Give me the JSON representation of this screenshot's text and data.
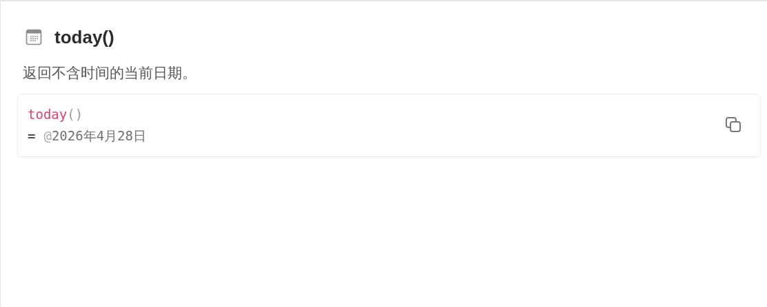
{
  "title": "today()",
  "description": "返回不含时间的当前日期。",
  "code_block": {
    "lines": [
      {
        "tokens": [
          {
            "kind": "function",
            "text": "today"
          },
          {
            "kind": "punctuation",
            "text": "()"
          }
        ]
      },
      {
        "tokens": [
          {
            "kind": "operator",
            "text": "="
          },
          {
            "kind": "mention",
            "text": "@"
          },
          {
            "kind": "value",
            "text": "2026年4月28日"
          }
        ]
      }
    ]
  }
}
